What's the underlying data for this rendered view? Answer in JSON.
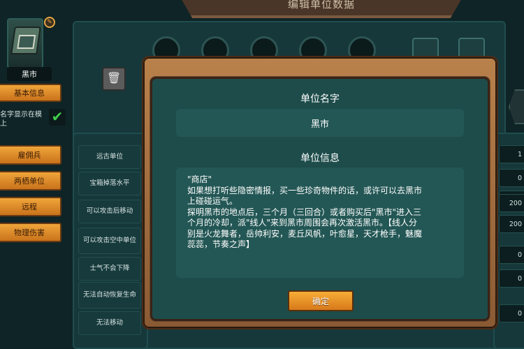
{
  "header": {
    "title": "编辑单位数据"
  },
  "unit": {
    "name": "黑市"
  },
  "left_panel": {
    "basic_info_button": "基本信息",
    "name_display_label": "名字显示在模\n上",
    "name_display_checked": true,
    "tag_buttons": [
      "雇佣兵",
      "两栖单位",
      "远程",
      "物理伤害"
    ]
  },
  "attributes": [
    "远古单位",
    "宝箱掉落水平",
    "可以攻击后移动",
    "可以攻击空中单位",
    "士气不会下降",
    "无法自动恢复生命",
    "无法移动"
  ],
  "right_values": [
    "1",
    "0",
    "0",
    "200",
    "200",
    "0",
    "0",
    "0"
  ],
  "dialog": {
    "name_title": "单位名字",
    "name_value": "黑市",
    "info_title": "单位信息",
    "info_text": "\"商店\"\n如果想打听些隐密情报，买一些珍奇物件的话，或许可以去黑市\n上碰碰运气。\n探明黑市的地点后，三个月（三回合）或者购买后\"黑市\"进入三\n个月的冷却，派\"线人\"来到黑市周围会再次激活黑市。【线人分\n别是火龙舞者，岳帅利安，麦丘风帆，叶愈星，天才枪手，魅魔\n蕊蕊，节奏之声】",
    "ok_button": "确定"
  },
  "colors": {
    "background": "#0f2426",
    "dialog_inner": "#1d4c4a",
    "dialog_frame": "#b9814b",
    "button_orange": "#f0a63a",
    "check_green": "#3fd14a"
  },
  "icons": {
    "trash": "trash-icon",
    "check": "check-icon",
    "gear": "gear-icon"
  }
}
